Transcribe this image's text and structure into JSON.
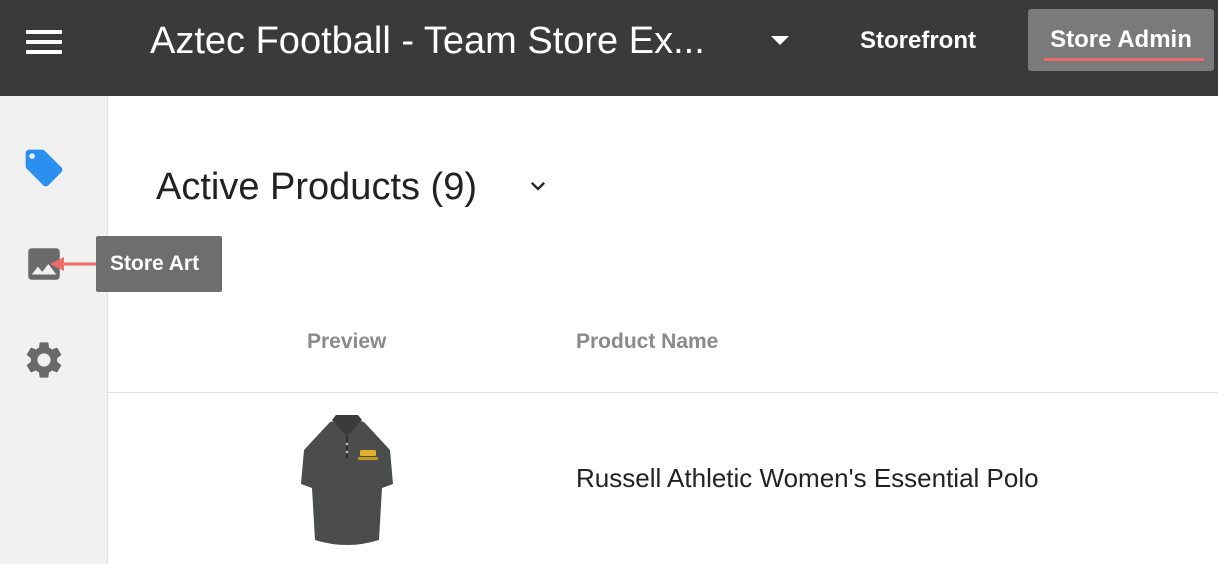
{
  "header": {
    "menu_icon": "hamburger-menu-icon",
    "store_title": "Aztec Football - Team Store Ex...",
    "store_dropdown_icon": "caret-down-icon",
    "nav": {
      "storefront": "Storefront",
      "store_admin": "Store Admin"
    },
    "active_nav": "Store Admin",
    "active_underline_color": "#ee6b6b"
  },
  "sidebar": {
    "items": [
      {
        "icon": "tag-icon",
        "color": "#2b8ff0",
        "active": true
      },
      {
        "icon": "image-icon",
        "color": "#6a6a6a",
        "active": false
      },
      {
        "icon": "gear-icon",
        "color": "#6a6a6a",
        "active": false
      }
    ]
  },
  "tooltip": {
    "label": "Store Art",
    "arrow_color": "#ee6b6b"
  },
  "main": {
    "section_title": "Active Products (9)",
    "section_dropdown_icon": "chevron-down-icon",
    "table": {
      "columns": [
        "Preview",
        "Product Name"
      ],
      "rows": [
        {
          "preview": "polo-shirt-image",
          "product_name": "Russell Athletic Women's Essential Polo"
        }
      ]
    }
  }
}
